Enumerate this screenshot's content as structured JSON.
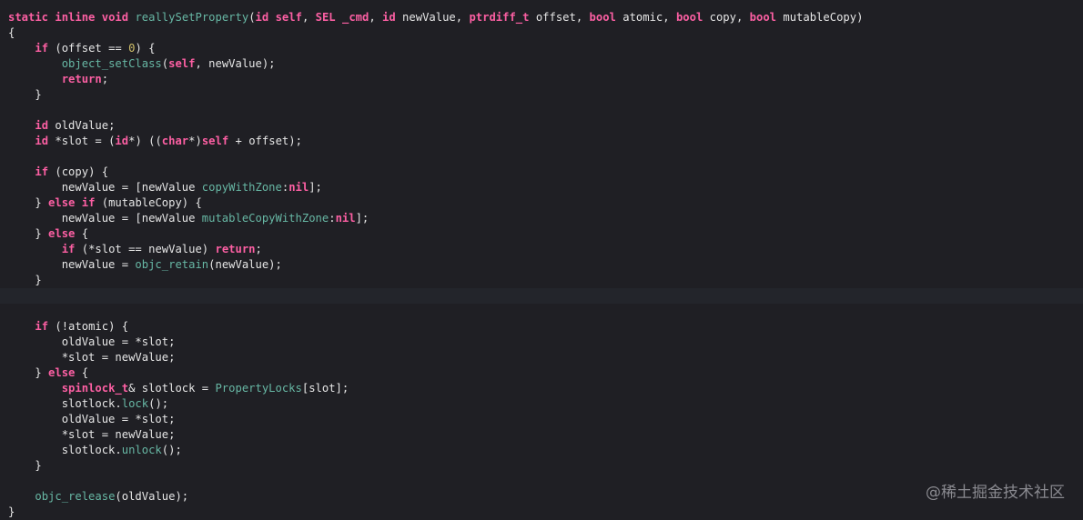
{
  "watermark": "@稀土掘金技术社区",
  "code_lines": [
    [
      [
        "kw",
        "static"
      ],
      [
        "p",
        " "
      ],
      [
        "kw",
        "inline"
      ],
      [
        "p",
        " "
      ],
      [
        "kw",
        "void"
      ],
      [
        "p",
        " "
      ],
      [
        "fn",
        "reallySetProperty"
      ],
      [
        "p",
        "("
      ],
      [
        "kw",
        "id"
      ],
      [
        "p",
        " "
      ],
      [
        "kw",
        "self"
      ],
      [
        "p",
        ", "
      ],
      [
        "kw",
        "SEL"
      ],
      [
        "p",
        " "
      ],
      [
        "kw",
        "_cmd"
      ],
      [
        "p",
        ", "
      ],
      [
        "kw",
        "id"
      ],
      [
        "p",
        " newValue, "
      ],
      [
        "kw",
        "ptrdiff_t"
      ],
      [
        "p",
        " offset, "
      ],
      [
        "kw",
        "bool"
      ],
      [
        "p",
        " atomic, "
      ],
      [
        "kw",
        "bool"
      ],
      [
        "p",
        " copy, "
      ],
      [
        "kw",
        "bool"
      ],
      [
        "p",
        " mutableCopy)"
      ]
    ],
    [
      [
        "p",
        "{"
      ]
    ],
    [
      [
        "p",
        "    "
      ],
      [
        "kw",
        "if"
      ],
      [
        "p",
        " (offset == "
      ],
      [
        "num",
        "0"
      ],
      [
        "p",
        ") {"
      ]
    ],
    [
      [
        "p",
        "        "
      ],
      [
        "fn",
        "object_setClass"
      ],
      [
        "p",
        "("
      ],
      [
        "kw",
        "self"
      ],
      [
        "p",
        ", newValue);"
      ]
    ],
    [
      [
        "p",
        "        "
      ],
      [
        "kw",
        "return"
      ],
      [
        "p",
        ";"
      ]
    ],
    [
      [
        "p",
        "    }"
      ]
    ],
    [
      [
        "p",
        ""
      ]
    ],
    [
      [
        "p",
        "    "
      ],
      [
        "kw",
        "id"
      ],
      [
        "p",
        " oldValue;"
      ]
    ],
    [
      [
        "p",
        "    "
      ],
      [
        "kw",
        "id"
      ],
      [
        "p",
        " *slot = ("
      ],
      [
        "kw",
        "id"
      ],
      [
        "p",
        "*) (("
      ],
      [
        "kw",
        "char"
      ],
      [
        "p",
        "*)"
      ],
      [
        "kw",
        "self"
      ],
      [
        "p",
        " + offset);"
      ]
    ],
    [
      [
        "p",
        ""
      ]
    ],
    [
      [
        "p",
        "    "
      ],
      [
        "kw",
        "if"
      ],
      [
        "p",
        " (copy) {"
      ]
    ],
    [
      [
        "p",
        "        newValue = [newValue "
      ],
      [
        "fn",
        "copyWithZone"
      ],
      [
        "p",
        ":"
      ],
      [
        "kw",
        "nil"
      ],
      [
        "p",
        "];"
      ]
    ],
    [
      [
        "p",
        "    } "
      ],
      [
        "kw",
        "else"
      ],
      [
        "p",
        " "
      ],
      [
        "kw",
        "if"
      ],
      [
        "p",
        " (mutableCopy) {"
      ]
    ],
    [
      [
        "p",
        "        newValue = [newValue "
      ],
      [
        "fn",
        "mutableCopyWithZone"
      ],
      [
        "p",
        ":"
      ],
      [
        "kw",
        "nil"
      ],
      [
        "p",
        "];"
      ]
    ],
    [
      [
        "p",
        "    } "
      ],
      [
        "kw",
        "else"
      ],
      [
        "p",
        " {"
      ]
    ],
    [
      [
        "p",
        "        "
      ],
      [
        "kw",
        "if"
      ],
      [
        "p",
        " (*slot == newValue) "
      ],
      [
        "kw",
        "return"
      ],
      [
        "p",
        ";"
      ]
    ],
    [
      [
        "p",
        "        newValue = "
      ],
      [
        "fn",
        "objc_retain"
      ],
      [
        "p",
        "(newValue);"
      ]
    ],
    [
      [
        "p",
        "    }"
      ]
    ],
    [
      [
        "p",
        ""
      ]
    ],
    [
      [
        "p",
        ""
      ]
    ],
    [
      [
        "p",
        "    "
      ],
      [
        "kw",
        "if"
      ],
      [
        "p",
        " (!atomic) {"
      ]
    ],
    [
      [
        "p",
        "        oldValue = *slot;"
      ]
    ],
    [
      [
        "p",
        "        *slot = newValue;"
      ]
    ],
    [
      [
        "p",
        "    } "
      ],
      [
        "kw",
        "else"
      ],
      [
        "p",
        " {"
      ]
    ],
    [
      [
        "p",
        "        "
      ],
      [
        "kw",
        "spinlock_t"
      ],
      [
        "p",
        "& slotlock = "
      ],
      [
        "fn",
        "PropertyLocks"
      ],
      [
        "p",
        "[slot];"
      ]
    ],
    [
      [
        "p",
        "        slotlock."
      ],
      [
        "fn",
        "lock"
      ],
      [
        "p",
        "();"
      ]
    ],
    [
      [
        "p",
        "        oldValue = *slot;"
      ]
    ],
    [
      [
        "p",
        "        *slot = newValue;"
      ]
    ],
    [
      [
        "p",
        "        slotlock."
      ],
      [
        "fn",
        "unlock"
      ],
      [
        "p",
        "();"
      ]
    ],
    [
      [
        "p",
        "    }"
      ]
    ],
    [
      [
        "p",
        ""
      ]
    ],
    [
      [
        "p",
        "    "
      ],
      [
        "fn",
        "objc_release"
      ],
      [
        "p",
        "(oldValue);"
      ]
    ],
    [
      [
        "p",
        "}"
      ]
    ]
  ]
}
